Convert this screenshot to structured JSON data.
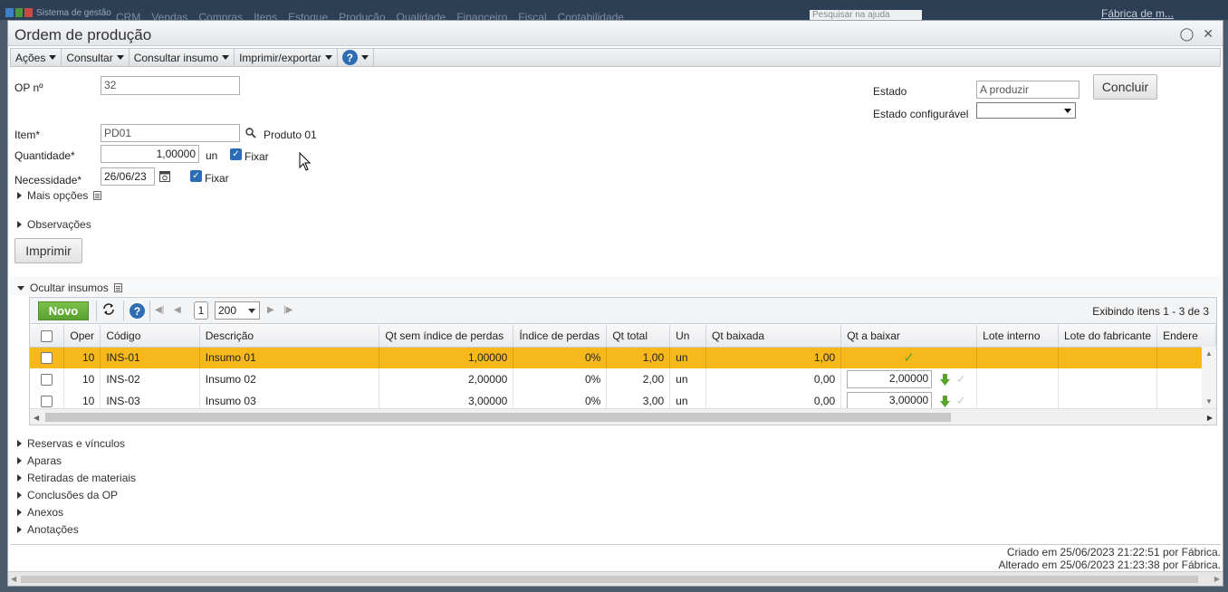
{
  "appbar": {
    "system_name": "Sistema de gestão",
    "menu": [
      "CRM",
      "Vendas",
      "Compras",
      "Itens",
      "Estoque",
      "Produção",
      "Qualidade",
      "Financeiro",
      "Fiscal",
      "Contabilidade"
    ],
    "help_search_placeholder": "Pesquisar na ajuda",
    "company": "Fábrica de m..."
  },
  "window": {
    "title": "Ordem de produção"
  },
  "toolbar": {
    "acoes": "Ações",
    "consultar": "Consultar",
    "consultar_insumo": "Consultar insumo",
    "imprimir_exportar": "Imprimir/exportar",
    "help": "?"
  },
  "form": {
    "op_label": "OP nº",
    "op_value": "32",
    "item_label": "Item*",
    "item_value": "PD01",
    "item_desc": "Produto 01",
    "quantidade_label": "Quantidade*",
    "quantidade_value": "1,00000",
    "quantidade_unit": "un",
    "fixar_label": "Fixar",
    "necessidade_label": "Necessidade*",
    "necessidade_value": "26/06/23",
    "fixar2_label": "Fixar",
    "estado_label": "Estado",
    "estado_value": "A produzir",
    "concluir_label": "Concluir",
    "estado_config_label": "Estado configurável",
    "estado_config_value": "",
    "mais_opcoes": "Mais opções",
    "observacoes": "Observações",
    "imprimir": "Imprimir",
    "ocultar_insumos": "Ocultar insumos"
  },
  "grid": {
    "novo": "Novo",
    "help": "?",
    "page": "1",
    "page_size": "200",
    "status": "Exibindo itens 1 - 3 de 3",
    "columns": [
      "Oper",
      "Código",
      "Descrição",
      "Qt sem índice de perdas",
      "Índice de perdas",
      "Qt total",
      "Un",
      "Qt baixada",
      "Qt a baixar",
      "Lote interno",
      "Lote do fabricante",
      "Endere"
    ],
    "rows": [
      {
        "oper": "10",
        "codigo": "INS-01",
        "descricao": "Insumo 01",
        "qt_sem": "1,00000",
        "indice": "0%",
        "qt_total": "1,00",
        "un": "un",
        "qt_baixada": "1,00",
        "qt_a_baixar": "",
        "lote_interno": "",
        "lote_fab": "",
        "endereco": ""
      },
      {
        "oper": "10",
        "codigo": "INS-02",
        "descricao": "Insumo 02",
        "qt_sem": "2,00000",
        "indice": "0%",
        "qt_total": "2,00",
        "un": "un",
        "qt_baixada": "0,00",
        "qt_a_baixar": "2,00000",
        "lote_interno": "",
        "lote_fab": "",
        "endereco": ""
      },
      {
        "oper": "10",
        "codigo": "INS-03",
        "descricao": "Insumo 03",
        "qt_sem": "3,00000",
        "indice": "0%",
        "qt_total": "3,00",
        "un": "un",
        "qt_baixada": "0,00",
        "qt_a_baixar": "3,00000",
        "lote_interno": "",
        "lote_fab": "",
        "endereco": ""
      }
    ]
  },
  "sections": [
    "Reservas e vínculos",
    "Aparas",
    "Retiradas de materiais",
    "Conclusões da OP",
    "Anexos",
    "Anotações"
  ],
  "footer": {
    "criado": "Criado em 25/06/2023 21:22:51 por Fábrica.",
    "alterado": "Alterado em 25/06/2023 21:23:38 por Fábrica."
  },
  "colors": {
    "selected_row": "#f6b81b",
    "novo_button": "#5aa12f",
    "help_blue": "#2f6db3",
    "checkbox_blue": "#2b6cb8"
  }
}
